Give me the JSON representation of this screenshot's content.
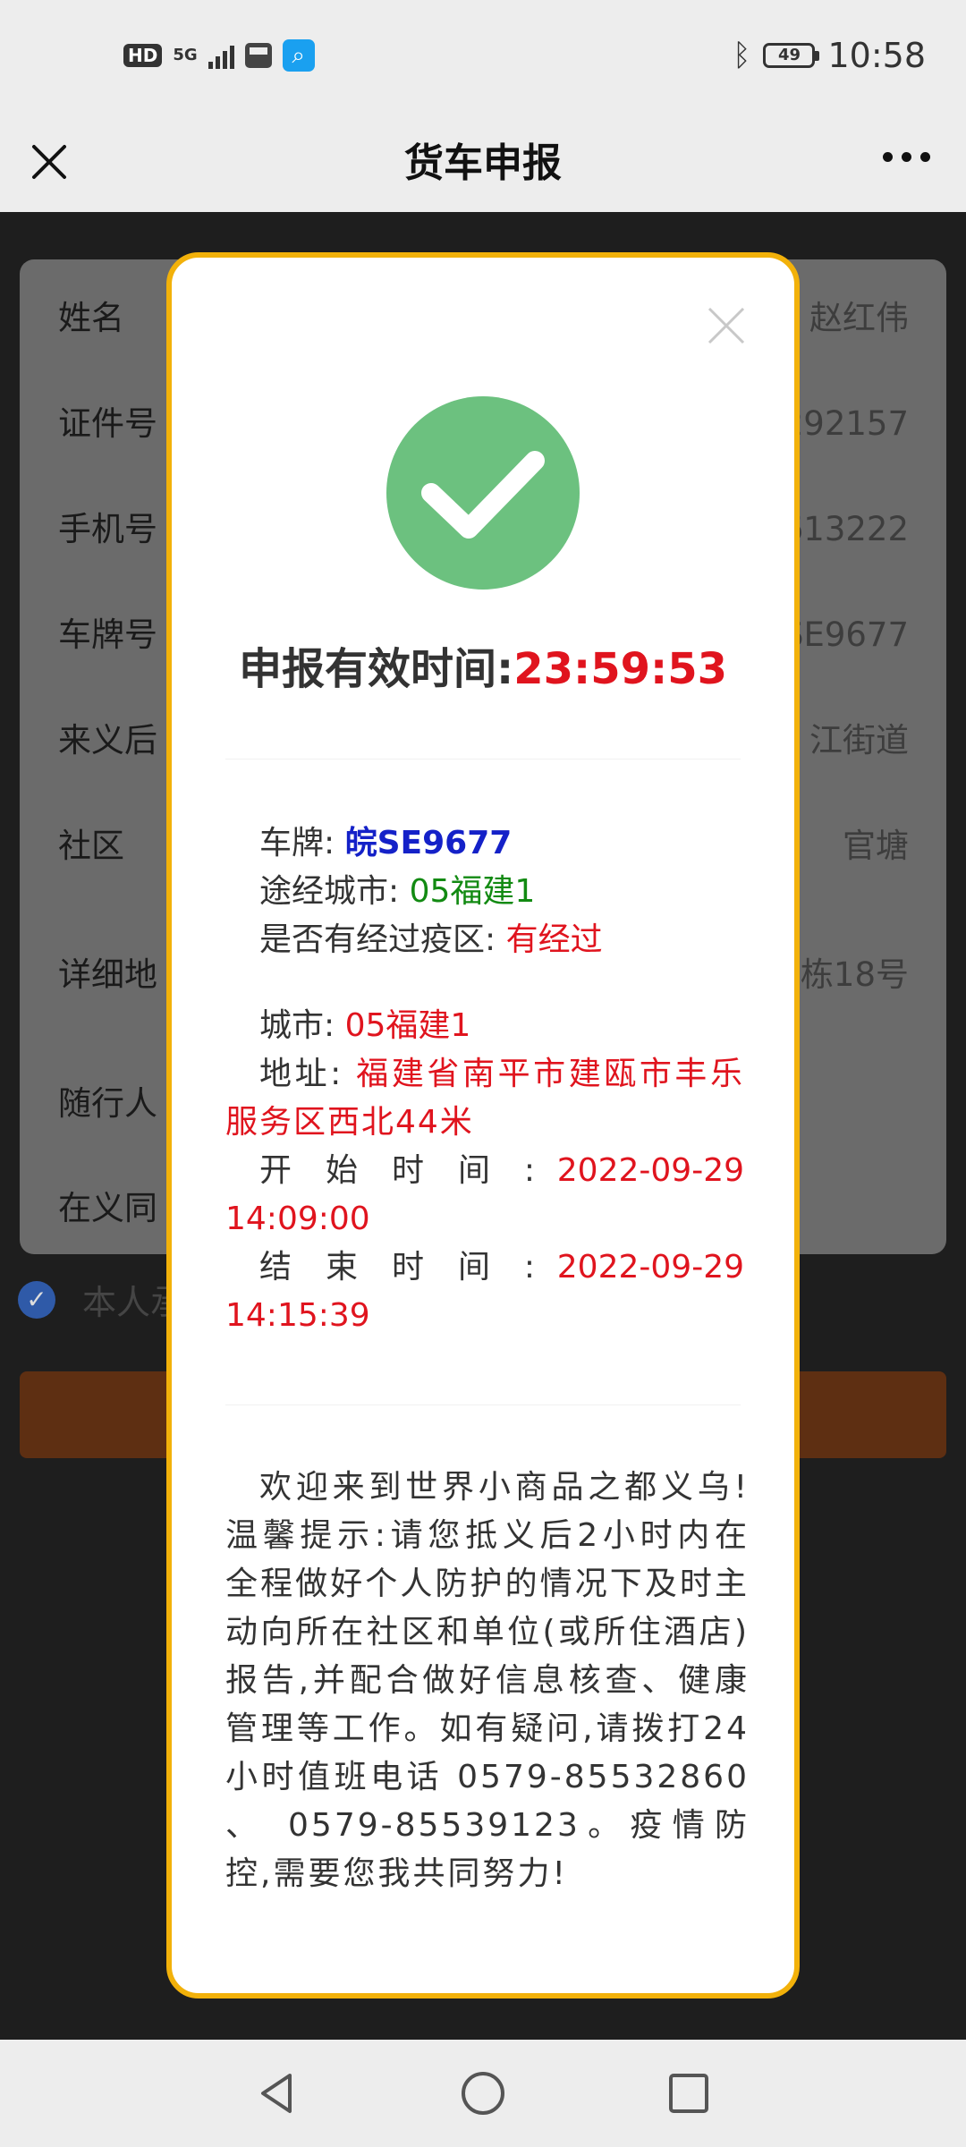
{
  "status_bar": {
    "hd_badge": "HD",
    "network": "5G",
    "battery_level": "49",
    "time": "10:58",
    "icons": [
      "hd-icon",
      "signal-icon",
      "truck-app-icon",
      "search-app-icon",
      "bluetooth-icon",
      "battery-icon"
    ]
  },
  "header": {
    "title": "货车申报",
    "close_icon": "close-icon",
    "more_icon": "more-icon"
  },
  "form": {
    "rows": [
      {
        "label": "姓名",
        "value": "赵红伟"
      },
      {
        "label": "证件号",
        "value": "292157"
      },
      {
        "label": "手机号",
        "value": "613222"
      },
      {
        "label": "车牌号",
        "value": "SE9677"
      },
      {
        "label": "来义后",
        "value": "江街道"
      },
      {
        "label": "社区",
        "value": "官塘"
      },
      {
        "label": "详细地",
        "value": "栋18号"
      },
      {
        "label": "随行人",
        "value": ""
      },
      {
        "label": "在义同",
        "value": ""
      }
    ],
    "self_label": "本人承"
  },
  "modal": {
    "valid_label": "申报有效时间:",
    "valid_time": "23:59:53",
    "plate_label": "车牌:",
    "plate_value": "皖SE9677",
    "route_label": "途经城市:",
    "route_value": "05福建1",
    "risk_label": "是否有经过疫区:",
    "risk_value": "有经过",
    "city_label": "城市:",
    "city_value": "05福建1",
    "address_label": "地址:",
    "address_value": "福建省南平市建瓯市丰乐服务区西北44米",
    "start_label": "开 始 时 间 :",
    "start_value": "2022-09-29 14:09:00",
    "end_label": "结 束 时 间 :",
    "end_value": "2022-09-29 14:15:39",
    "notice": "欢迎来到世界小商品之都义乌! 温馨提示:请您抵义后2小时内在全程做好个人防护的情况下及时主动向所在社区和单位(或所住酒店)报告,并配合做好信息核查、健康管理等工作。如有疑问,请拨打24小时值班电话 0579-85532860 、 0579-85539123。疫情防控,需要您我共同努力!"
  },
  "colors": {
    "accent_border": "#f2b10a",
    "success_green": "#6cc17f",
    "red_text": "#e0141e",
    "blue_text": "#1421c8",
    "green_text": "#128a12"
  }
}
